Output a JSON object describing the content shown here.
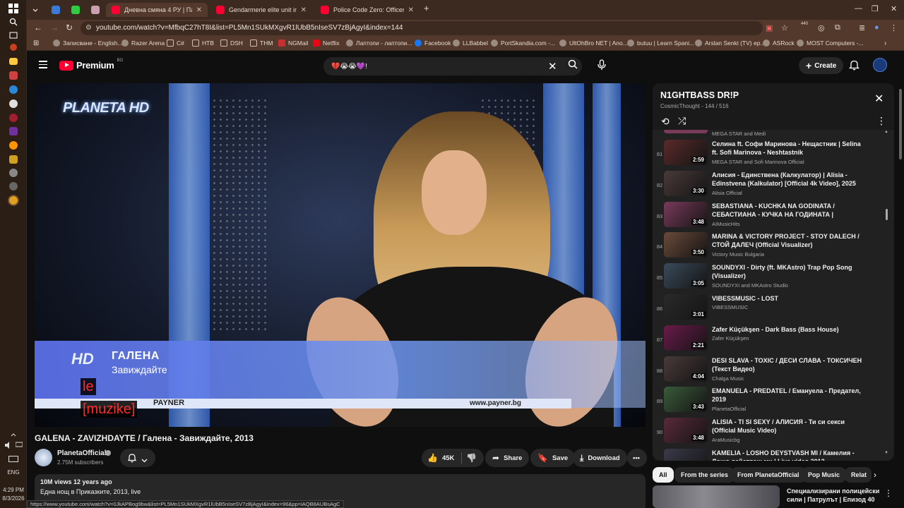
{
  "taskbar": {
    "lang": "ENG",
    "time": "4:29 PM",
    "date": "8/3/2026"
  },
  "browser": {
    "tabs": [
      {
        "label": "Дневна смяна 4 РУ | Патр..."
      },
      {
        "label": "Gendarmerie elite unit in actio..."
      },
      {
        "label": "Police Code Zero: Officer U..."
      }
    ],
    "new_tab": "+",
    "url": "youtube.com/watch?v=MfbqC27hT8I&list=PL5Mn1SUkMXgvR1lUbB5nIseSV7zBjAgyI&index=144",
    "ext_badge": "440",
    "bookmarks": [
      "Записване - English...",
      "Razer Arena",
      "C#",
      "НТВ",
      "DSH",
      "THM",
      "NGMail",
      "Netflix",
      "Лаптопи - лаптопи...",
      "Facebook",
      "LLBabbel",
      "PortSkandia.com -...",
      "UltOhBro NET | Ano...",
      "butuu | Learn Spani...",
      "Arslan Senki (TV) ep...",
      "ASRock",
      "MOST Computers -..."
    ]
  },
  "header": {
    "logo_text": "Premium",
    "logo_region": "BG",
    "search_value": "💔😭😭💜!",
    "create_label": "Create"
  },
  "player": {
    "channel_logo": "PLANETA HD",
    "lt_hd": "HD",
    "lt_artist": "ГАЛЕНА",
    "lt_song": "Завиждайте",
    "lt_label": "PAYNER",
    "lt_url": "www.payner.bg",
    "caption_line1": "le",
    "caption_line2": "[muzike]"
  },
  "video": {
    "title": "GALENA - ZAVIZHDAYTE / Галена - Завиждайте, 2013",
    "channel": "PlanetaOfficial",
    "subscribers": "2.75M subscribers",
    "likes": "45K",
    "share_label": "Share",
    "save_label": "Save",
    "download_label": "Download",
    "views_meta": "10M views  12 years ago",
    "desc_line": "Една нощ в Приказките, 2013, live"
  },
  "status_url": "https://www.youtube.com/watch?v=0JkAPBog9bw&list=PL5Mn1SUkMXgvR1lUbB5nIseSV7zBjAgyI&index=96&pp=iAQB8AUBsAgC",
  "playlist": {
    "title": "N1GHTBASS DR!P",
    "owner": "CosmicThought",
    "position": "144 / 516",
    "partial_top_channel": "MEGA STAR and Medi",
    "items": [
      {
        "idx": "81",
        "title": "Селина ft. Софи Маринова - Нещастник | Selina ft. Sofi Marinova - Neshtastnik",
        "channel": "MEGA STAR and Sofi Marinova Official",
        "duration": "2:59",
        "color": "#5a2a2a"
      },
      {
        "idx": "82",
        "title": "Алисия - Единствена (Калкулатор) | Alisia - Edinstvena (Kalkulator) [Official 4k Video], 2025",
        "channel": "Alisia Official",
        "duration": "3:30",
        "color": "#4a3a3a"
      },
      {
        "idx": "83",
        "title": "SEBASTIANA - KUCHKA NA GODINATA / СЕБАСТИАНА - КУЧКА НА ГОДИНАТА | OFFICIAL...",
        "channel": "AIMusicHits",
        "duration": "3:48",
        "color": "#7a3a5a"
      },
      {
        "idx": "84",
        "title": "MARINA & VICTORY PROJECT - STOY DALECH / СТОЙ ДАЛЕЧ (Official Visualizer)",
        "channel": "Victory Music Bulgaria",
        "duration": "3:50",
        "color": "#6a4a3a"
      },
      {
        "idx": "85",
        "title": "SOUNDYXI - Dirty (ft. MKAstro) Trap Pop Song (Visualizer)",
        "channel": "SOUNDYXI and MKAstro Studio",
        "duration": "3:05",
        "color": "#3a4a5a"
      },
      {
        "idx": "86",
        "title": "VIBESSMUSIC - LOST",
        "channel": "VIBESSMUSIC",
        "duration": "3:01",
        "color": "#2a2a2a"
      },
      {
        "idx": "87",
        "title": "Zafer Küçükşen - Dark Bass (Bass House)",
        "channel": "Zafer Küçükşen",
        "duration": "2:21",
        "color": "#6a1a4a"
      },
      {
        "idx": "88",
        "title": "DESI SLAVA - TOXIC / ДЕСИ СЛАВА - ТОКСИЧЕН (Текст Видео)",
        "channel": "Chalga Music",
        "duration": "4:04",
        "color": "#4a3a3a"
      },
      {
        "idx": "89",
        "title": "EMANUELA - PREDATEL / Емануела - Предател, 2019",
        "channel": "PlanetaOfficial",
        "duration": "3:43",
        "color": "#3a5a3a"
      },
      {
        "idx": "90",
        "title": "ALISIA - TI SI SEXY / АЛИСИЯ - Ти си секси (Official Music Video)",
        "channel": "AraMusicbg",
        "duration": "3:48",
        "color": "#5a2a3a"
      },
      {
        "idx": "91",
        "title": "KAMELIA - LOSHO DEYSTVASH MI / Камелия - Лошо действаш ми | Live video 2012",
        "channel": "",
        "duration": "",
        "color": "#3a3a4a"
      }
    ]
  },
  "chips": [
    "All",
    "From the series",
    "From PlanetaOfficial",
    "Pop Music",
    "Relat"
  ],
  "recommended": {
    "title": "Специализирани полицейски сили | Патрулът | Епизод 40"
  }
}
